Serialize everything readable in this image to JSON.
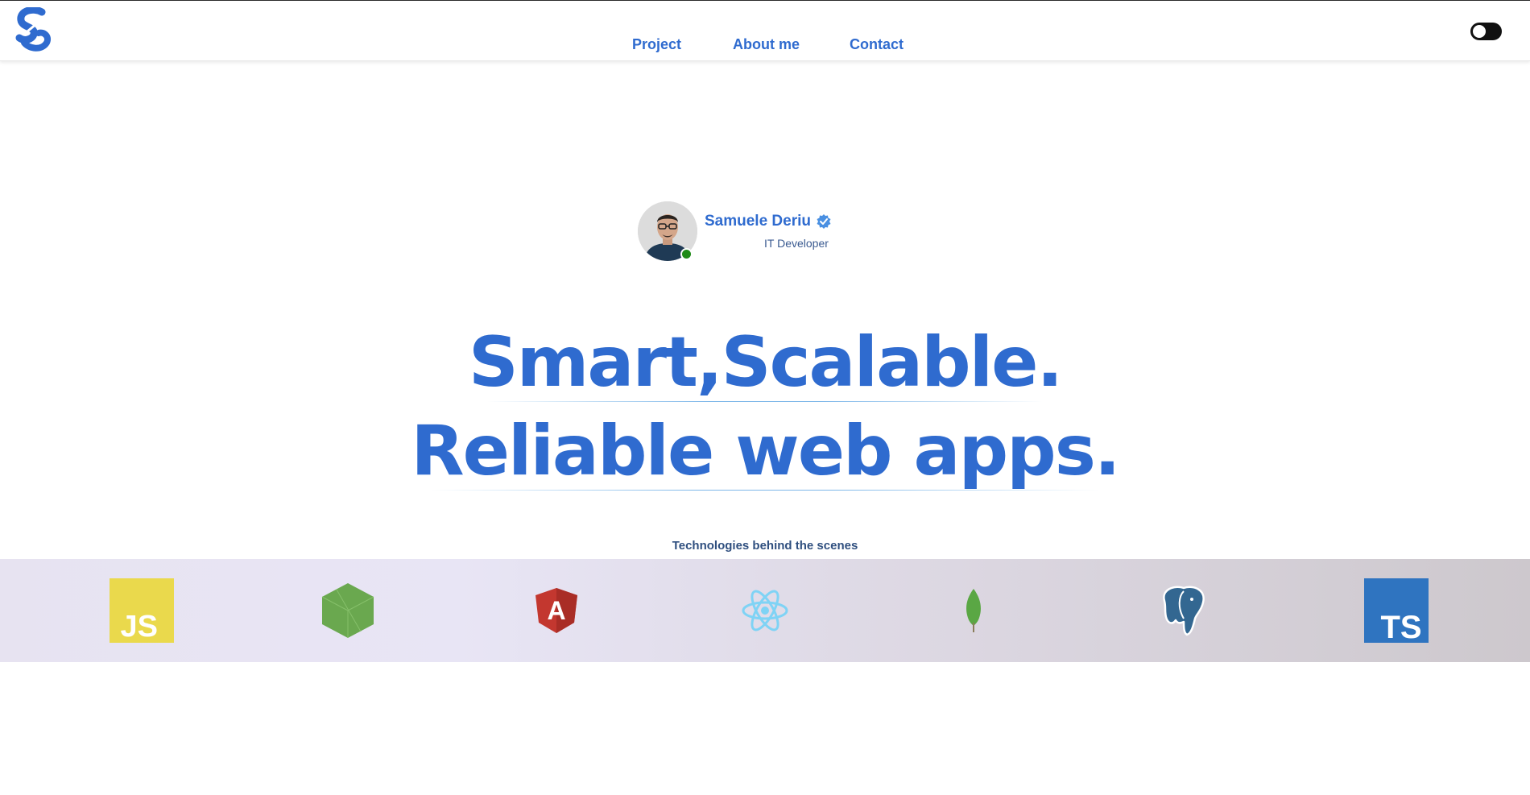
{
  "nav": {
    "items": [
      {
        "label": "Project"
      },
      {
        "label": "About me"
      },
      {
        "label": "Contact"
      }
    ]
  },
  "theme_toggle": {
    "state": "off"
  },
  "profile": {
    "name": "Samuele Deriu",
    "role": "IT Developer",
    "status": "online"
  },
  "hero": {
    "line1": "Smart,Scalable.",
    "line2": "Reliable web apps."
  },
  "technologies": {
    "caption": "Technologies behind the scenes",
    "items": [
      {
        "icon": "javascript-icon",
        "label": "JS"
      },
      {
        "icon": "nodejs-icon"
      },
      {
        "icon": "angular-icon",
        "label": "A"
      },
      {
        "icon": "react-icon"
      },
      {
        "icon": "mongodb-icon"
      },
      {
        "icon": "postgresql-icon"
      },
      {
        "icon": "typescript-icon",
        "label": "TS"
      }
    ]
  },
  "colors": {
    "accent": "#2f6bcf",
    "online": "#1f8a17",
    "javascript": "#ead94c",
    "nodejs": "#6aa84f",
    "angular": "#c3372f",
    "react": "#7fd3f5",
    "mongodb": "#5aa744",
    "postgresql": "#336791",
    "typescript": "#2f74c0"
  }
}
